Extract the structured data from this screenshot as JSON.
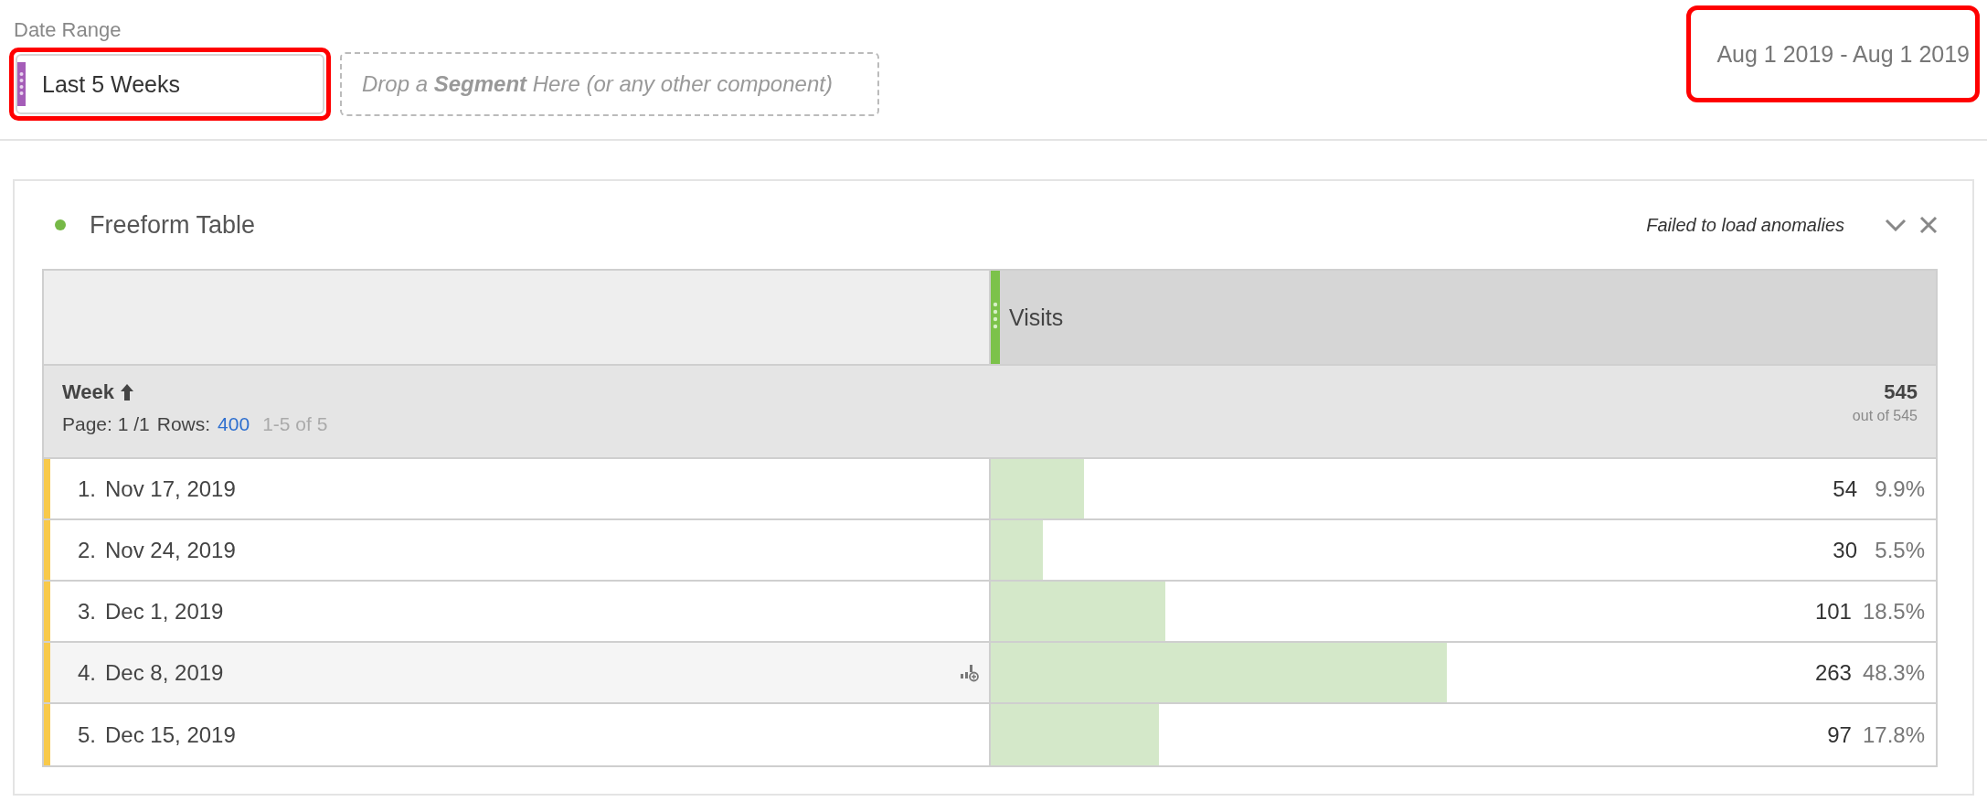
{
  "date_range": {
    "label": "Date Range",
    "component": "Last 5 Weeks",
    "drop_zone": "Drop a **Segment** Here (or any other component)",
    "dates": "Aug 1 2019 - Aug 1 2019"
  },
  "panel": {
    "title": "Freeform Table",
    "status": "Failed to load anomalies",
    "table": {
      "metric": "Visits",
      "dimension": "Week",
      "page": "Page: 1 /1",
      "rows_label": "Rows:",
      "rows_count": "400",
      "range": "1-5 of 5",
      "total": "545",
      "total_sub": "out of 545",
      "rows": [
        {
          "index": "1.",
          "label": "Nov 17, 2019",
          "value": "54",
          "percent": "9.9%",
          "level": 0.099,
          "hovered": false
        },
        {
          "index": "2.",
          "label": "Nov 24, 2019",
          "value": "30",
          "percent": "5.5%",
          "level": 0.055,
          "hovered": false
        },
        {
          "index": "3.",
          "label": "Dec 1, 2019",
          "value": "101",
          "percent": "18.5%",
          "level": 0.185,
          "hovered": false
        },
        {
          "index": "4.",
          "label": "Dec 8, 2019",
          "value": "263",
          "percent": "48.3%",
          "level": 0.483,
          "hovered": true
        },
        {
          "index": "5.",
          "label": "Dec 15, 2019",
          "value": "97",
          "percent": "17.8%",
          "level": 0.178,
          "hovered": false
        }
      ]
    }
  }
}
